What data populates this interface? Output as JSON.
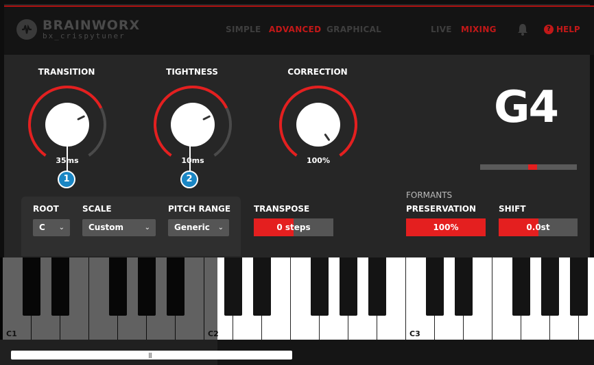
{
  "brand": {
    "name": "BRAINWORX",
    "sub": "bx_crispytuner"
  },
  "nav": {
    "left": [
      {
        "label": "SIMPLE",
        "active": false
      },
      {
        "label": "ADVANCED",
        "active": true
      },
      {
        "label": "GRAPHICAL",
        "active": false
      }
    ],
    "right": [
      {
        "label": "LIVE",
        "active": false
      },
      {
        "label": "MIXING",
        "active": true
      }
    ],
    "help": "HELP"
  },
  "knobs": {
    "transition": {
      "label": "TRANSITION",
      "value": "35ms",
      "level": 0.72
    },
    "tightness": {
      "label": "TIGHTNESS",
      "value": "10ms",
      "level": 0.72
    },
    "correction": {
      "label": "CORRECTION",
      "value": "100%",
      "level": 1.0
    }
  },
  "callouts": {
    "one": "1",
    "two": "2"
  },
  "note": "G4",
  "tuner_offset": 0.0,
  "controls": {
    "root": {
      "label": "ROOT",
      "value": "C"
    },
    "scale": {
      "label": "SCALE",
      "value": "Custom"
    },
    "pitch_range": {
      "label": "PITCH RANGE",
      "value": "Generic"
    },
    "transpose": {
      "label": "TRANSPOSE",
      "value": "0 steps",
      "fill": 0.5
    }
  },
  "formants": {
    "title": "FORMANTS",
    "preservation": {
      "label": "PRESERVATION",
      "value": "100%",
      "fill": 1.0
    },
    "shift": {
      "label": "SHIFT",
      "value": "0.0st",
      "fill": 0.5
    }
  },
  "keyboard": {
    "labels": [
      "C1",
      "C2",
      "C3"
    ]
  },
  "colors": {
    "accent": "#e41f1f",
    "callout": "#1a86c4",
    "panel": "#262626"
  },
  "icons": [
    "logo-icon",
    "bell-icon",
    "help-icon",
    "chevron-down-icon"
  ]
}
